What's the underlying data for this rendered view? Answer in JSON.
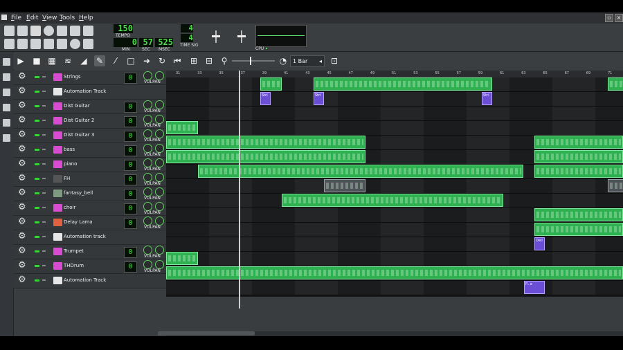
{
  "menu": [
    "File",
    "Edit",
    "View",
    "Tools",
    "Help"
  ],
  "lcd": {
    "tempo": "150",
    "tempo_label": "TEMPO",
    "min": "0",
    "sec": "57",
    "msec": "525",
    "min_label": "MIN",
    "sec_label": "SEC",
    "msec_label": "MSEC",
    "timesig_num": "4",
    "timesig_den": "4",
    "timesig_label": "TIME SIG",
    "cpu_label": "CPU"
  },
  "editor": {
    "quantize": "1 Bar"
  },
  "timeline_ticks": [
    "31",
    "33",
    "35",
    "37",
    "39",
    "41",
    "43",
    "45",
    "47",
    "49",
    "51",
    "53",
    "55",
    "57",
    "59",
    "61",
    "63",
    "65",
    "67",
    "69",
    "71"
  ],
  "tracks": [
    {
      "name": "Strings",
      "type": "instrument",
      "vol": "0",
      "icon_color": "#d94bd1"
    },
    {
      "name": "Automation Track",
      "type": "automation",
      "icon_color": "#e6e6e6"
    },
    {
      "name": "Dist Guitar",
      "type": "instrument",
      "vol": "0",
      "icon_color": "#d94bd1"
    },
    {
      "name": "Dist Guitar 2",
      "type": "instrument",
      "vol": "0",
      "icon_color": "#d94bd1"
    },
    {
      "name": "Dist Guitar 3",
      "type": "instrument",
      "vol": "0",
      "icon_color": "#d94bd1"
    },
    {
      "name": "bass",
      "type": "instrument",
      "vol": "0",
      "icon_color": "#d94bd1"
    },
    {
      "name": "piano",
      "type": "instrument",
      "vol": "0",
      "icon_color": "#d94bd1"
    },
    {
      "name": "FH",
      "type": "instrument",
      "vol": "0",
      "icon_color": "#555555"
    },
    {
      "name": "fantasy_bell",
      "type": "instrument",
      "vol": "0",
      "icon_color": "#7f9b7f"
    },
    {
      "name": "choir",
      "type": "instrument",
      "vol": "0",
      "icon_color": "#d94bd1"
    },
    {
      "name": "Delay Lama",
      "type": "instrument",
      "vol": "0",
      "icon_color": "#e06040"
    },
    {
      "name": "Automation track",
      "type": "automation",
      "icon_color": "#e6e6e6"
    },
    {
      "name": "Trumpet",
      "type": "instrument",
      "vol": "0",
      "icon_color": "#d94bd1"
    },
    {
      "name": "THDrum",
      "type": "instrument",
      "vol": "0",
      "icon_color": "#d94bd1"
    },
    {
      "name": "Automation Track",
      "type": "automation",
      "icon_color": "#e6e6e6"
    }
  ],
  "vol_label": "VOL",
  "pan_label": "PAN",
  "auto_clips": [
    "Stri",
    "Stri",
    "Stri",
    "Dell",
    "P...e"
  ],
  "colors": {
    "clip_green": "#2fb152",
    "lcd_green": "#4cdc4c",
    "automation_purple": "#6a4fd6"
  }
}
